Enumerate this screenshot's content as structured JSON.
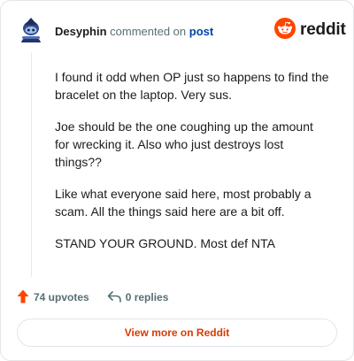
{
  "header": {
    "author": "Desyphin",
    "action_text": "commented on",
    "post_link": "post",
    "logo_text": "reddit"
  },
  "comment": {
    "paragraphs": [
      "I found it odd when OP just so happens to find the bracelet on the laptop. Very sus.",
      "Joe should be the one coughing up the amount for wrecking it. Also who just destroys lost things??",
      "Like what everyone said here, most probably a scam. All the things said here are a bit off.",
      "STAND YOUR GROUND. Most def NTA"
    ]
  },
  "actions": {
    "upvotes_label": "74 upvotes",
    "replies_label": "0 replies"
  },
  "cta": {
    "label": "View more on Reddit"
  },
  "colors": {
    "brand": "#ff4500",
    "link": "#0045ac",
    "cta_text": "#d93a00",
    "muted": "#576f76"
  },
  "icons": [
    "avatar",
    "reddit-logo-icon",
    "upvote-arrow-icon",
    "reply-icon"
  ]
}
